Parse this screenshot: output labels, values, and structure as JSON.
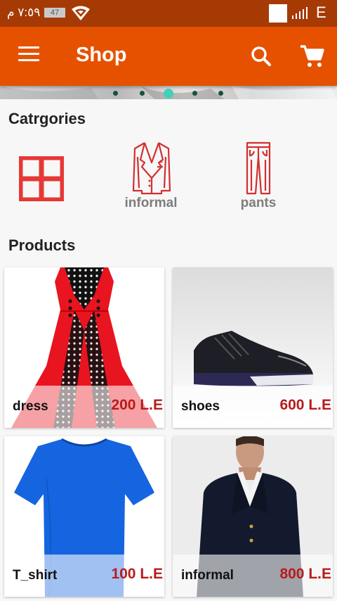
{
  "status_bar": {
    "time": "٧:٥٩ م",
    "battery": "47",
    "network": "E"
  },
  "app_bar": {
    "title": "Shop",
    "menu_icon": "menu-icon",
    "search_icon": "search-icon",
    "cart_icon": "shopping-cart-icon"
  },
  "carousel": {
    "dots": 5,
    "active_index": 2
  },
  "categories": {
    "title": "Catrgories",
    "items": [
      {
        "label": "",
        "icon": "grid-icon"
      },
      {
        "label": "informal",
        "icon": "blazer-icon"
      },
      {
        "label": "pants",
        "icon": "pants-icon"
      }
    ]
  },
  "products": {
    "title": "Products",
    "items": [
      {
        "name": "dress",
        "price": "200 L.E"
      },
      {
        "name": "shoes",
        "price": "600 L.E"
      },
      {
        "name": "T_shirt",
        "price": "100 L.E"
      },
      {
        "name": "informal",
        "price": "800 L.E"
      }
    ]
  },
  "colors": {
    "status_bar": "#a63a04",
    "app_bar": "#e65100",
    "category_icon": "#d32f2f",
    "price": "#b71c1c",
    "dot_active": "#43d0b8"
  }
}
